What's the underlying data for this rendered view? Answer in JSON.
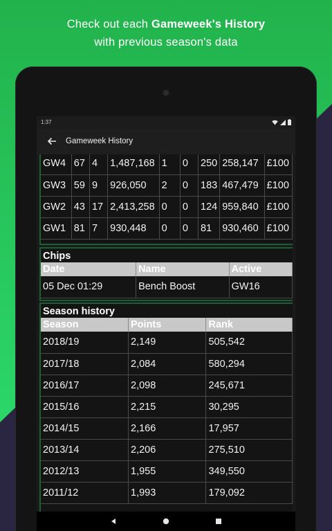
{
  "promo": {
    "line1_prefix": "Check out each ",
    "line1_bold": "Gameweek's History",
    "line2": "with previous season's data"
  },
  "status": {
    "time": "1:37"
  },
  "appbar": {
    "title": "Gameweek History"
  },
  "gameweeks": [
    [
      "GW4",
      "67",
      "4",
      "1,487,168",
      "1",
      "0",
      "250",
      "258,147",
      "£100"
    ],
    [
      "GW3",
      "59",
      "9",
      "926,050",
      "2",
      "0",
      "183",
      "467,479",
      "£100"
    ],
    [
      "GW2",
      "43",
      "17",
      "2,413,258",
      "0",
      "0",
      "124",
      "959,840",
      "£100"
    ],
    [
      "GW1",
      "81",
      "7",
      "930,448",
      "0",
      "0",
      "81",
      "930,460",
      "£100"
    ]
  ],
  "chips": {
    "title": "Chips",
    "headers": [
      "Date",
      "Name",
      "Active"
    ],
    "rows": [
      [
        "05 Dec 01:29",
        "Bench Boost",
        "GW16"
      ]
    ]
  },
  "season_history": {
    "title": "Season history",
    "headers": [
      "Season",
      "Points",
      "Rank"
    ],
    "rows": [
      [
        "2018/19",
        "2,149",
        "505,542"
      ],
      [
        "2017/18",
        "2,084",
        "580,294"
      ],
      [
        "2016/17",
        "2,098",
        "245,671"
      ],
      [
        "2015/16",
        "2,215",
        "30,295"
      ],
      [
        "2014/15",
        "2,166",
        "17,957"
      ],
      [
        "2013/14",
        "2,206",
        "275,510"
      ],
      [
        "2012/13",
        "1,955",
        "349,550"
      ],
      [
        "2011/12",
        "1,993",
        "179,092"
      ]
    ]
  },
  "colors": {
    "background_green": "#1fba55",
    "dark_corner": "#2a2540",
    "panel_border": "#1d5e36",
    "header_gray": "#c8c8c8"
  },
  "icons": [
    "back-arrow-icon",
    "wifi-icon",
    "signal-icon",
    "battery-icon",
    "nav-back-icon",
    "nav-home-icon",
    "nav-recents-icon"
  ]
}
